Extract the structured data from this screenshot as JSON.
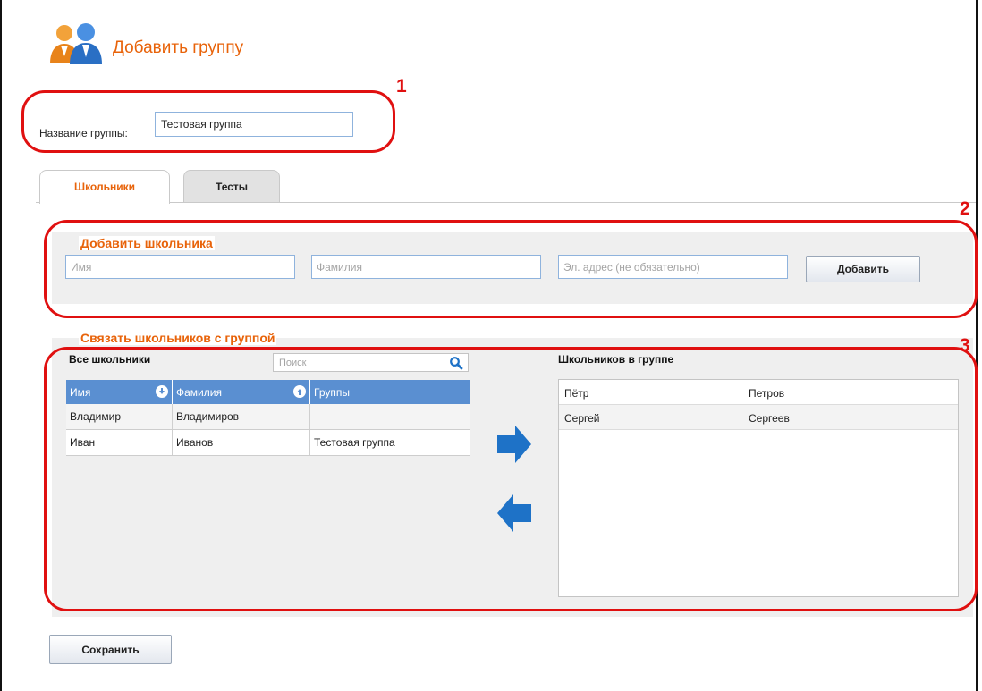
{
  "header": {
    "title": "Добавить группу",
    "icon": "users-icon"
  },
  "annotations": [
    "1",
    "2",
    "3"
  ],
  "group_name": {
    "label": "Название группы:",
    "value": "Тестовая группа"
  },
  "tabs": [
    {
      "label": "Школьники",
      "active": true
    },
    {
      "label": "Тесты",
      "active": false
    }
  ],
  "add_student": {
    "legend": "Добавить школьника",
    "first_name_placeholder": "Имя",
    "last_name_placeholder": "Фамилия",
    "email_placeholder": "Эл. адрес (не обязательно)",
    "add_button": "Добавить"
  },
  "link_students": {
    "legend": "Связать школьников с группой",
    "all_students": {
      "title": "Все школьники",
      "search_placeholder": "Поиск",
      "columns": [
        "Имя",
        "Фамилия",
        "Группы"
      ],
      "rows": [
        [
          "Владимир",
          "Владимиров",
          ""
        ],
        [
          "Иван",
          "Иванов",
          "Тестовая группа"
        ]
      ]
    },
    "in_group": {
      "title": "Школьников в группе",
      "rows": [
        [
          "Пётр",
          "Петров"
        ],
        [
          "Сергей",
          "Сергеев"
        ]
      ]
    },
    "move_right_icon": "arrow-right-icon",
    "move_left_icon": "arrow-left-icon"
  },
  "save_button": "Сохранить",
  "colors": {
    "accent": "#e8630a",
    "annotation": "#e01010",
    "table_header": "#5a8fd1",
    "arrow": "#1e72c7",
    "panel_bg": "#efefef"
  }
}
